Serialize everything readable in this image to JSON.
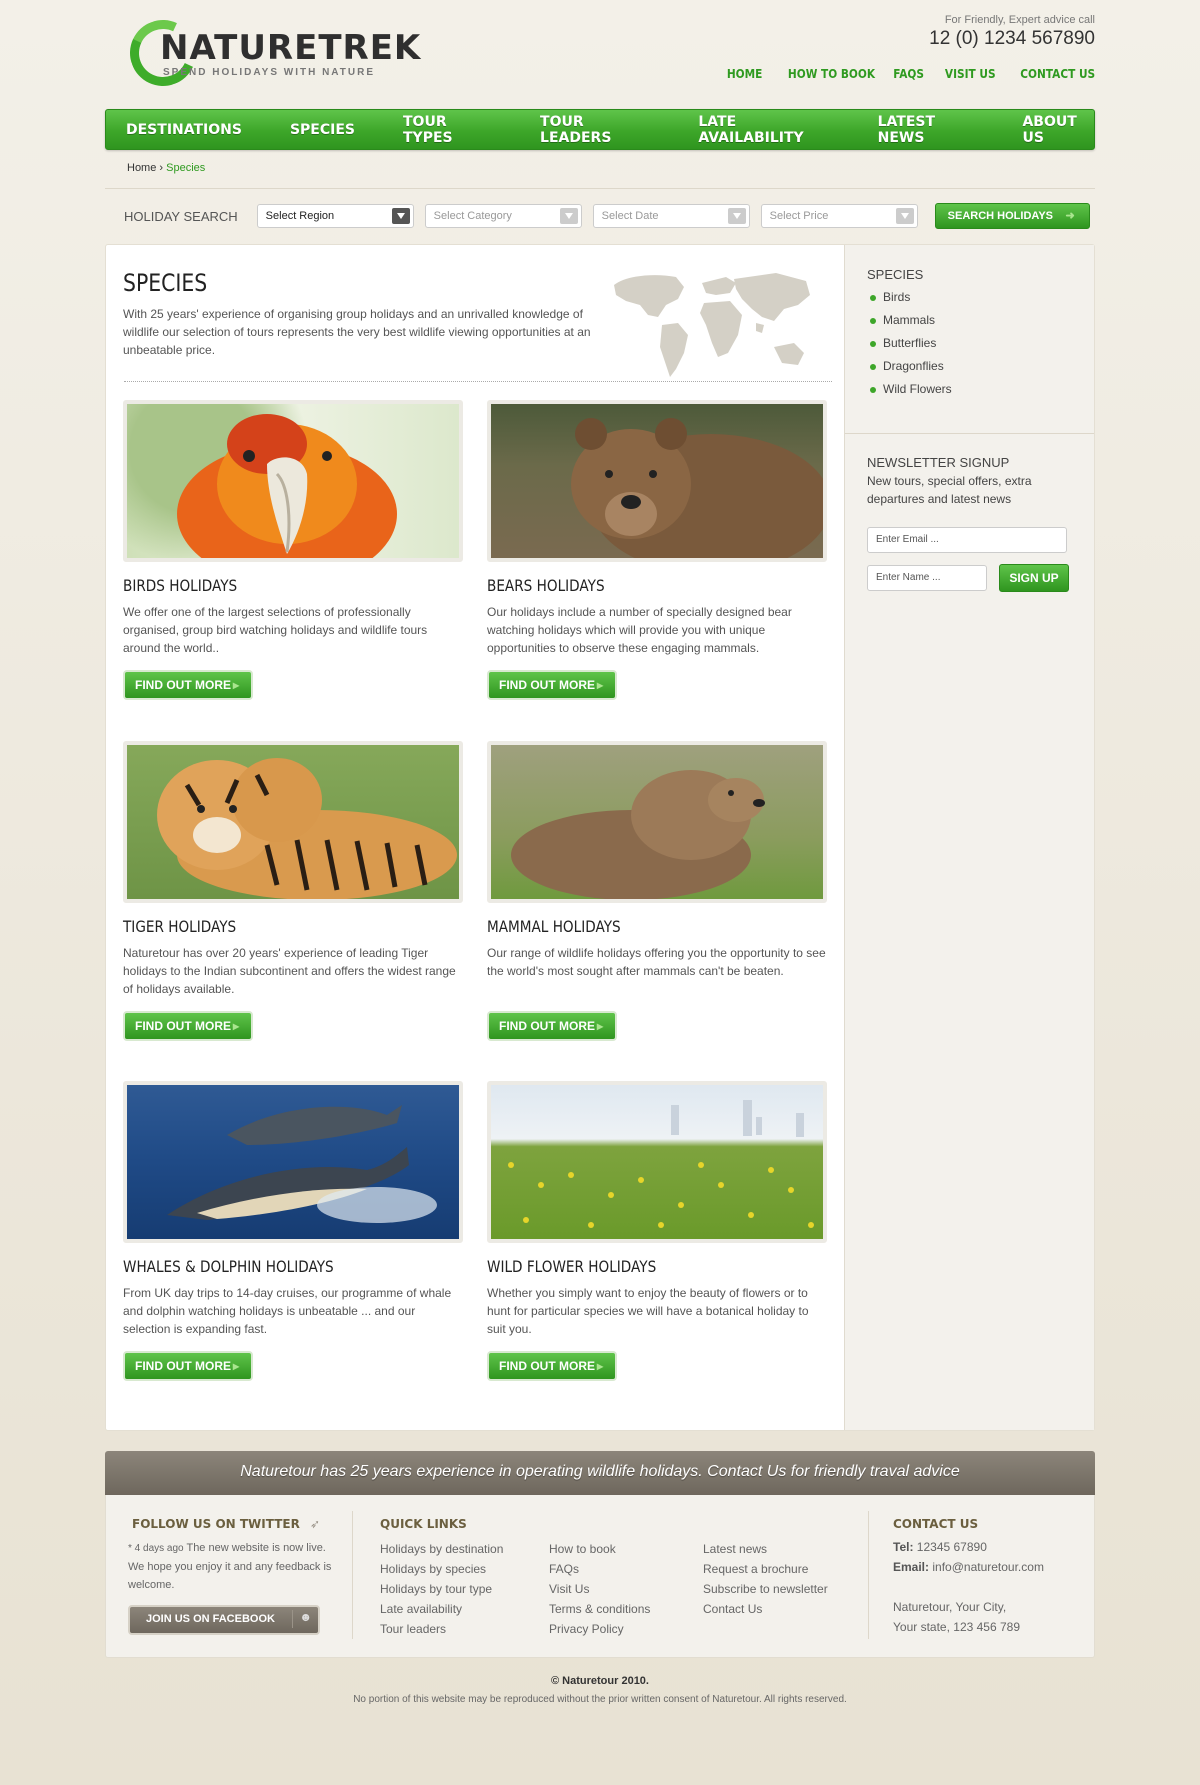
{
  "brand": {
    "name": "NATURETREK",
    "tagline": "SPEND HOLIDAYS WITH NATURE"
  },
  "header": {
    "advice_text": "For Friendly, Expert advice call",
    "phone": "12 (0) 1234 567890",
    "topnav": [
      "HOME",
      "HOW TO BOOK",
      "FAQS",
      "VISIT US",
      "CONTACT US"
    ]
  },
  "mainnav": [
    "DESTINATIONS",
    "SPECIES",
    "TOUR TYPES",
    "TOUR LEADERS",
    "LATE AVAILABILITY",
    "LATEST NEWS",
    "ABOUT US"
  ],
  "breadcrumb": {
    "home": "Home",
    "sep": " › ",
    "current": "Species"
  },
  "search": {
    "label": "HOLIDAY SEARCH",
    "region": "Select Region",
    "category": "Select Category",
    "date": "Select Date",
    "price": "Select Price",
    "button": "SEARCH HOLIDAYS"
  },
  "intro": {
    "title": "SPECIES",
    "text": "With 25 years' experience of organising group holidays and an unrivalled knowledge of wildlife our selection of tours represents the very best wildlife viewing opportunities at an unbeatable price."
  },
  "cards": [
    {
      "title": "BIRDS HOLIDAYS",
      "text": "We offer one of the largest selections of professionally organised, group bird watching holidays and wildlife tours around the world..",
      "button": "FIND OUT MORE"
    },
    {
      "title": "BEARS HOLIDAYS",
      "text": "Our holidays include a number of specially designed bear watching holidays which will provide you with unique opportunities to observe these engaging mammals.",
      "button": "FIND OUT MORE"
    },
    {
      "title": "TIGER HOLIDAYS",
      "text": "Naturetour has over 20 years' experience of leading Tiger holidays to the Indian subcontinent and offers the widest range of holidays available.",
      "button": "FIND OUT MORE"
    },
    {
      "title": "MAMMAL HOLIDAYS",
      "text": "Our range of wildlife holidays offering you the opportunity to see the world's most sought after mammals can't be beaten.",
      "button": "FIND OUT MORE"
    },
    {
      "title": "WHALES & DOLPHIN HOLIDAYS",
      "text": "From UK day trips to 14-day cruises, our programme of whale and dolphin watching holidays is unbeatable ... and our selection is expanding fast.",
      "button": "FIND OUT MORE"
    },
    {
      "title": "WILD FLOWER HOLIDAYS",
      "text": "Whether you simply want to enjoy the beauty of flowers or to hunt for particular species we will have a botanical holiday to suit you.",
      "button": "FIND OUT MORE"
    }
  ],
  "sidebar": {
    "species_title": "SPECIES",
    "species": [
      "Birds",
      "Mammals",
      "Butterflies",
      "Dragonflies",
      "Wild Flowers"
    ],
    "newsletter_title": "NEWSLETTER SIGNUP",
    "newsletter_text": "New tours, special offers, extra departures and latest news",
    "email_placeholder": "Enter Email ...",
    "name_placeholder": "Enter Name ...",
    "signup": "SIGN UP"
  },
  "footer": {
    "banner": "Naturetour has 25 years experience in operating wildlife holidays.  Contact Us for friendly traval advice",
    "twitter_title": "FOLLOW US ON TWITTER",
    "tweet_time": "* 4 days ago",
    "tweet_text": "The new website is now live. We hope you enjoy it and any feedback is welcome.",
    "facebook": "JOIN US ON FACEBOOK",
    "quick_title": "QUICK LINKS",
    "links_col1": [
      "Holidays by destination",
      "Holidays by species",
      "Holidays by tour type",
      "Late availability",
      "Tour leaders"
    ],
    "links_col2": [
      "How to book",
      "FAQs",
      "Visit Us",
      "Terms & conditions",
      "Privacy Policy"
    ],
    "links_col3": [
      "Latest news",
      "Request a brochure",
      "Subscribe to newsletter",
      "Contact Us"
    ],
    "contact_title": "CONTACT US",
    "tel_label": "Tel:",
    "tel": "12345 67890",
    "email_label": "Email:",
    "email": "info@naturetour.com",
    "address1": "Naturetour, Your City,",
    "address2": "Your state, 123 456 789",
    "copyright": "© Naturetour 2010.",
    "legal": "No portion of this website may be reproduced without the prior written consent of Naturetour. All rights reserved."
  },
  "colors": {
    "accent": "#3da629",
    "accent_dark": "#2f951f",
    "footer_bar": "#7a7368",
    "background": "#efebe2"
  }
}
